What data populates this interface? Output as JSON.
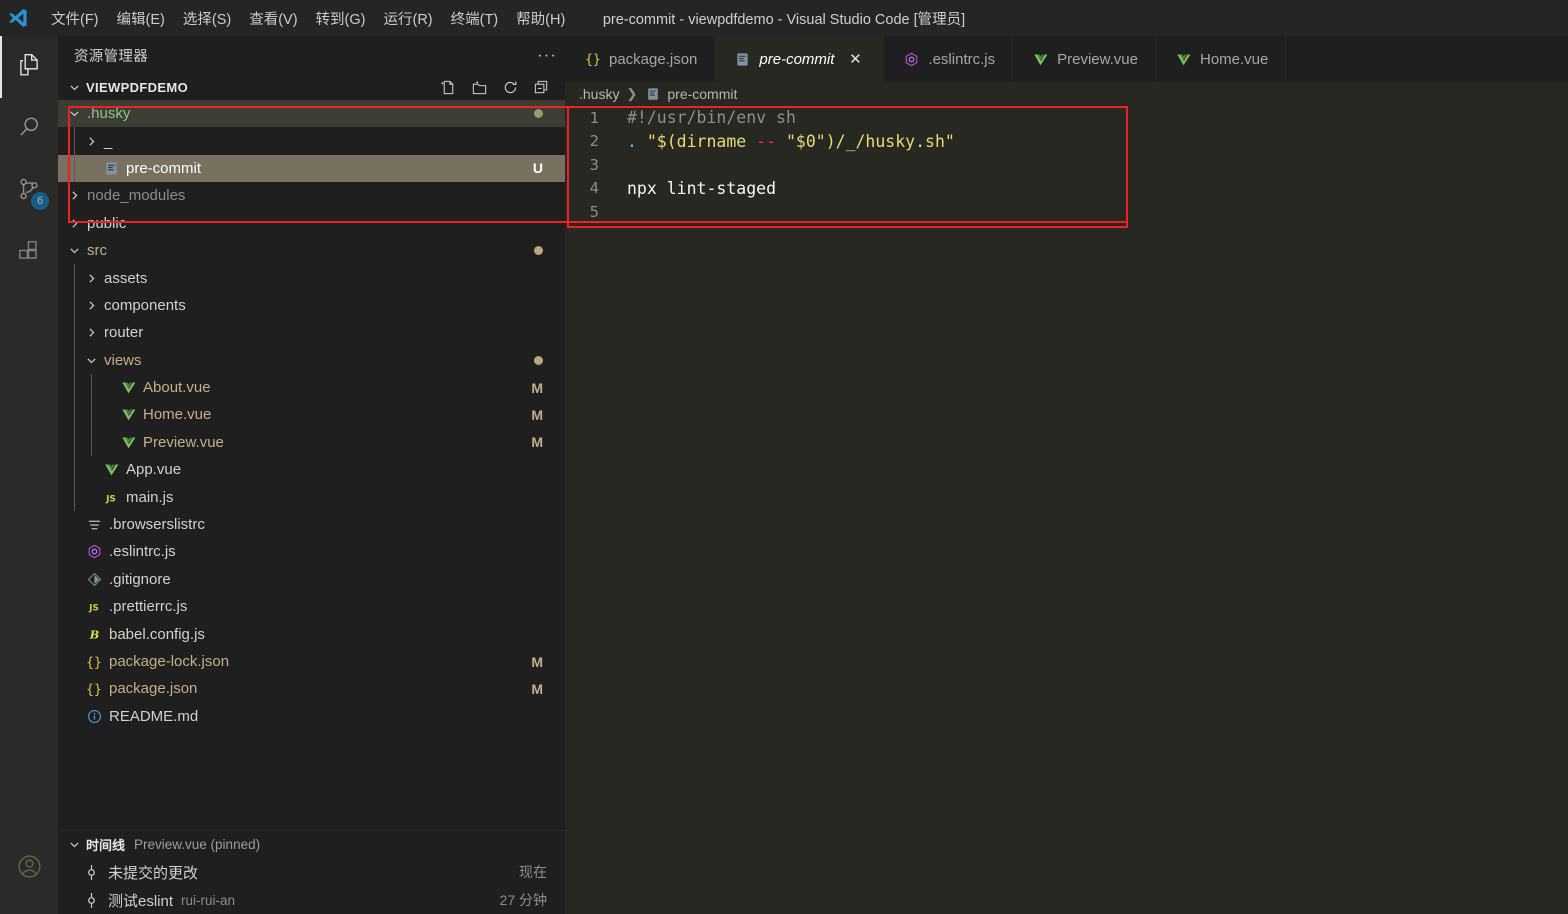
{
  "window": {
    "title": "pre-commit - viewpdfdemo - Visual Studio Code [管理员]",
    "logo_icon": "vscode-logo-icon"
  },
  "menubar": [
    {
      "label": "文件(F)",
      "name": "menu-file"
    },
    {
      "label": "编辑(E)",
      "name": "menu-edit"
    },
    {
      "label": "选择(S)",
      "name": "menu-selection"
    },
    {
      "label": "查看(V)",
      "name": "menu-view"
    },
    {
      "label": "转到(G)",
      "name": "menu-go"
    },
    {
      "label": "运行(R)",
      "name": "menu-run"
    },
    {
      "label": "终端(T)",
      "name": "menu-terminal"
    },
    {
      "label": "帮助(H)",
      "name": "menu-help"
    }
  ],
  "activitybar": {
    "items": [
      {
        "icon": "files-explorer-icon",
        "active": true
      },
      {
        "icon": "search-icon",
        "active": false
      },
      {
        "icon": "source-control-branch-icon",
        "active": false,
        "badge": "6"
      },
      {
        "icon": "extensions-icon",
        "active": false
      }
    ],
    "badge_color": "#0e7ac4",
    "account_icon": "account-person-icon"
  },
  "sidebar": {
    "title": "资源管理器",
    "more_label": "···",
    "tree_header": {
      "label": "VIEWPDFDEMO",
      "actions": [
        {
          "icon": "new-file-icon"
        },
        {
          "icon": "new-folder-icon"
        },
        {
          "icon": "refresh-icon"
        },
        {
          "icon": "collapse-all-icon"
        }
      ]
    },
    "tree": [
      {
        "label": ".husky",
        "indent": 0,
        "twisty": "down",
        "icon": "",
        "color": "green",
        "dot": "#89a36a",
        "row": "olive"
      },
      {
        "label": "_",
        "indent": 1,
        "twisty": "right",
        "icon": "",
        "color": "plain",
        "status": ""
      },
      {
        "label": "pre-commit",
        "indent": 1,
        "twisty": "",
        "icon": "shell-file-icon",
        "color": "white",
        "status": "U",
        "row": "selected"
      },
      {
        "label": "node_modules",
        "indent": 0,
        "twisty": "right",
        "icon": "",
        "color": "dim"
      },
      {
        "label": "public",
        "indent": 0,
        "twisty": "right",
        "icon": "",
        "color": "plain"
      },
      {
        "label": "src",
        "indent": 0,
        "twisty": "down",
        "icon": "",
        "color": "mod",
        "dot": "#bba77f"
      },
      {
        "label": "assets",
        "indent": 1,
        "twisty": "right",
        "icon": "",
        "color": "plain"
      },
      {
        "label": "components",
        "indent": 1,
        "twisty": "right",
        "icon": "",
        "color": "plain"
      },
      {
        "label": "router",
        "indent": 1,
        "twisty": "right",
        "icon": "",
        "color": "plain"
      },
      {
        "label": "views",
        "indent": 1,
        "twisty": "down",
        "icon": "",
        "color": "mod",
        "dot": "#bba77f"
      },
      {
        "label": "About.vue",
        "indent": 2,
        "twisty": "",
        "icon": "vue-icon",
        "color": "mod",
        "status": "M"
      },
      {
        "label": "Home.vue",
        "indent": 2,
        "twisty": "",
        "icon": "vue-icon",
        "color": "mod",
        "status": "M"
      },
      {
        "label": "Preview.vue",
        "indent": 2,
        "twisty": "",
        "icon": "vue-icon",
        "color": "mod",
        "status": "M"
      },
      {
        "label": "App.vue",
        "indent": 1,
        "twisty": "",
        "icon": "vue-icon",
        "color": "plain"
      },
      {
        "label": "main.js",
        "indent": 1,
        "twisty": "",
        "icon": "js-icon",
        "color": "plain"
      },
      {
        "label": ".browserslistrc",
        "indent": 0,
        "twisty": "",
        "icon": "config-lines-icon",
        "color": "plain"
      },
      {
        "label": ".eslintrc.js",
        "indent": 0,
        "twisty": "",
        "icon": "eslint-icon",
        "color": "plain"
      },
      {
        "label": ".gitignore",
        "indent": 0,
        "twisty": "",
        "icon": "git-icon",
        "color": "plain"
      },
      {
        "label": ".prettierrc.js",
        "indent": 0,
        "twisty": "",
        "icon": "js-icon",
        "color": "plain"
      },
      {
        "label": "babel.config.js",
        "indent": 0,
        "twisty": "",
        "icon": "babel-icon",
        "color": "plain"
      },
      {
        "label": "package-lock.json",
        "indent": 0,
        "twisty": "",
        "icon": "json-icon",
        "color": "mod",
        "status": "M"
      },
      {
        "label": "package.json",
        "indent": 0,
        "twisty": "",
        "icon": "json-icon",
        "color": "mod",
        "status": "M"
      },
      {
        "label": "README.md",
        "indent": 0,
        "twisty": "",
        "icon": "info-md-icon",
        "color": "plain"
      }
    ]
  },
  "timeline": {
    "title": "时间线",
    "subtitle": "Preview.vue (pinned)",
    "rows": [
      {
        "icon": "git-commit-icon",
        "label": "未提交的更改",
        "author": "",
        "time": "现在"
      },
      {
        "icon": "git-commit-icon",
        "label": "测试eslint",
        "author": "rui-rui-an",
        "time": "27 分钟"
      }
    ]
  },
  "editor": {
    "tabs": [
      {
        "label": "package.json",
        "icon": "json-icon",
        "active": false,
        "italic": false
      },
      {
        "label": "pre-commit",
        "icon": "shell-file-icon",
        "active": true,
        "italic": true,
        "close": "✕"
      },
      {
        "label": ".eslintrc.js",
        "icon": "eslint-icon",
        "active": false,
        "italic": false
      },
      {
        "label": "Preview.vue",
        "icon": "vue-icon",
        "active": false,
        "italic": false
      },
      {
        "label": "Home.vue",
        "icon": "vue-icon",
        "active": false,
        "italic": false
      }
    ],
    "breadcrumb": {
      "folder": ".husky",
      "separator": "❯",
      "file_icon": "shell-file-icon",
      "file": "pre-commit"
    },
    "lines": [
      {
        "no": "1",
        "tokens": [
          {
            "t": "#!/usr/bin/env sh",
            "c": "comment"
          }
        ]
      },
      {
        "no": "2",
        "tokens": [
          {
            "t": ".",
            "c": "dot"
          },
          {
            "t": " ",
            "c": "plain"
          },
          {
            "t": "\"$(dirname ",
            "c": "string"
          },
          {
            "t": "--",
            "c": "punct"
          },
          {
            "t": " \"$0\")/_/husky.sh\"",
            "c": "string"
          }
        ]
      },
      {
        "no": "3",
        "tokens": []
      },
      {
        "no": "4",
        "tokens": [
          {
            "t": "npx lint-staged",
            "c": "plain"
          }
        ]
      },
      {
        "no": "5",
        "tokens": []
      }
    ]
  },
  "annotations": {
    "color": "#ee2222",
    "boxes": [
      {
        "name": "annot-tree-husky-folder"
      },
      {
        "name": "annot-code-block"
      }
    ]
  }
}
